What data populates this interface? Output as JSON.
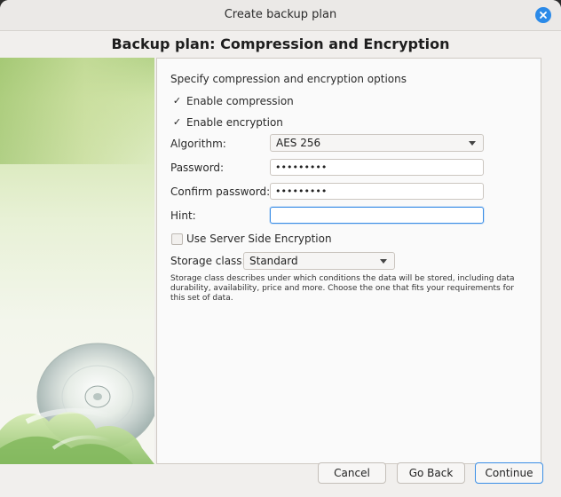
{
  "window": {
    "title": "Create backup plan"
  },
  "page": {
    "heading": "Backup plan: Compression and Encryption"
  },
  "panel": {
    "intro": "Specify compression and encryption options",
    "enable_compression": {
      "label": "Enable compression",
      "checked": true
    },
    "enable_encryption": {
      "label": "Enable encryption",
      "checked": true
    },
    "algorithm": {
      "label": "Algorithm:",
      "value": "AES 256"
    },
    "password": {
      "label": "Password:",
      "value": "•••••••••"
    },
    "confirm_password": {
      "label": "Confirm password:",
      "value": "•••••••••"
    },
    "hint": {
      "label": "Hint:",
      "value": ""
    },
    "server_side_encryption": {
      "label": "Use Server Side Encryption",
      "checked": false
    },
    "storage_class": {
      "label": "Storage class:",
      "value": "Standard"
    },
    "storage_description": "Storage class describes under which conditions the data will be stored, including data durability, availability, price and more. Choose the one that fits your requirements for this set of data."
  },
  "buttons": {
    "cancel": "Cancel",
    "go_back": "Go Back",
    "continue": "Continue"
  },
  "colors": {
    "accent": "#2b8ae8",
    "focus_border": "#3a8ee6"
  },
  "icons": {
    "close": "close-icon",
    "check": "checkmark-icon",
    "dropdown": "chevron-down-icon",
    "illustration": "cd-disc-icon"
  }
}
